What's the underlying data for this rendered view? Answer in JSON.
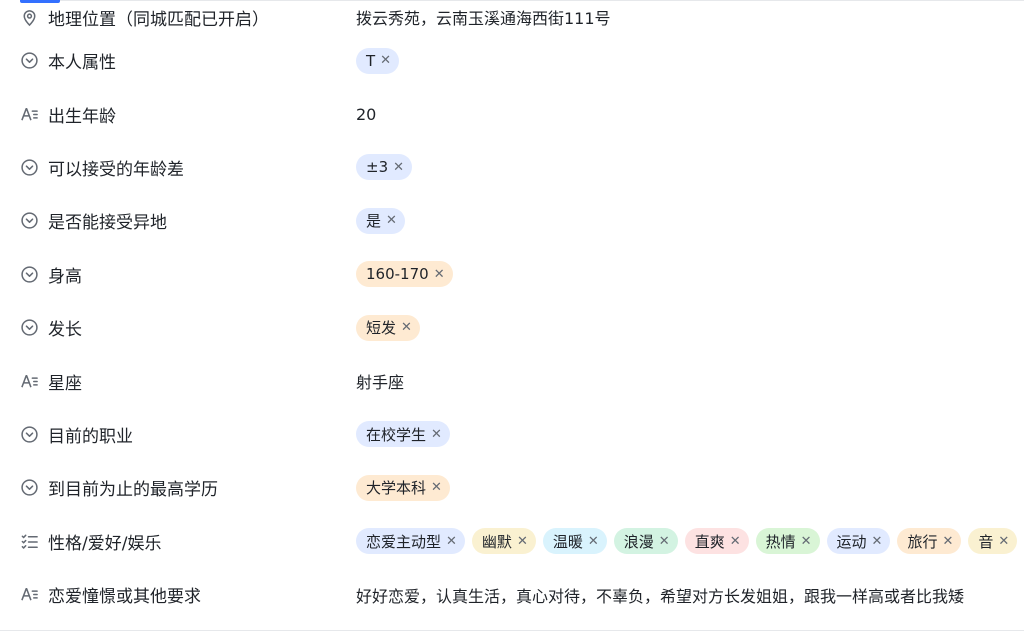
{
  "fields": [
    {
      "label": "地理位置（同城匹配已开启）",
      "icon": "location-pin-icon",
      "type": "text",
      "value": "拨云秀苑，云南玉溪通海西街111号"
    },
    {
      "label": "本人属性",
      "icon": "chevron-circle-icon",
      "type": "tags",
      "tags": [
        {
          "text": "T",
          "color": "#e1eaff"
        }
      ]
    },
    {
      "label": "出生年龄",
      "icon": "text-field-icon",
      "type": "text",
      "value": "20"
    },
    {
      "label": "可以接受的年龄差",
      "icon": "chevron-circle-icon",
      "type": "tags",
      "tags": [
        {
          "text": "±3",
          "color": "#e1eaff"
        }
      ]
    },
    {
      "label": "是否能接受异地",
      "icon": "chevron-circle-icon",
      "type": "tags",
      "tags": [
        {
          "text": "是",
          "color": "#e1eaff"
        }
      ]
    },
    {
      "label": "身高",
      "icon": "chevron-circle-icon",
      "type": "tags",
      "tags": [
        {
          "text": "160-170",
          "color": "#feead2"
        }
      ]
    },
    {
      "label": "发长",
      "icon": "chevron-circle-icon",
      "type": "tags",
      "tags": [
        {
          "text": "短发",
          "color": "#feead2"
        }
      ]
    },
    {
      "label": "星座",
      "icon": "text-field-icon",
      "type": "text",
      "value": "射手座"
    },
    {
      "label": "目前的职业",
      "icon": "chevron-circle-icon",
      "type": "tags",
      "tags": [
        {
          "text": "在校学生",
          "color": "#e1eaff"
        }
      ]
    },
    {
      "label": "到目前为止的最高学历",
      "icon": "chevron-circle-icon",
      "type": "tags",
      "tags": [
        {
          "text": "大学本科",
          "color": "#feead2"
        }
      ]
    },
    {
      "label": "性格/爱好/娱乐",
      "icon": "checklist-icon",
      "type": "tags",
      "tags": [
        {
          "text": "恋爱主动型",
          "color": "#e1eaff"
        },
        {
          "text": "幽默",
          "color": "#faf1d1"
        },
        {
          "text": "温暖",
          "color": "#d9f3fd"
        },
        {
          "text": "浪漫",
          "color": "#d3f3e2"
        },
        {
          "text": "直爽",
          "color": "#fde2e2"
        },
        {
          "text": "热情",
          "color": "#d9f5d6"
        },
        {
          "text": "运动",
          "color": "#e1eaff"
        },
        {
          "text": "旅行",
          "color": "#feead2"
        },
        {
          "text": "音",
          "color": "#faf1d1"
        }
      ]
    },
    {
      "label": "恋爱憧憬或其他要求",
      "icon": "text-field-icon",
      "type": "text",
      "value": "好好恋爱，认真生活，真心对待，不辜负，希望对方长发姐姐，跟我一样高或者比我矮"
    }
  ],
  "colors": {
    "accent": "#3370ff",
    "border": "#e6e8eb"
  }
}
